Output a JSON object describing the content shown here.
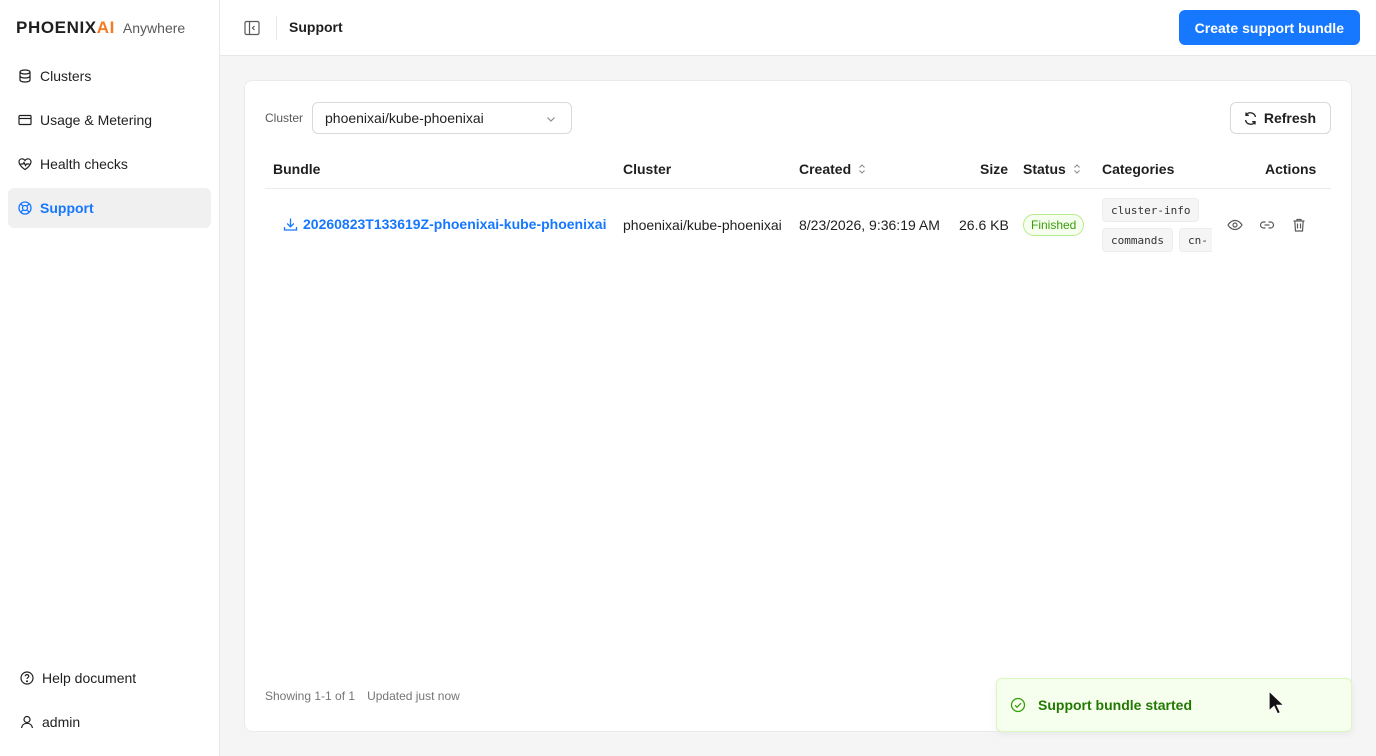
{
  "app": {
    "logo_brand": "PHOENIX",
    "logo_brand_ai": "AI",
    "logo_sub": "Anywhere"
  },
  "sidebar": {
    "items": [
      {
        "label": "Clusters",
        "icon": "database-icon"
      },
      {
        "label": "Usage & Metering",
        "icon": "card-icon"
      },
      {
        "label": "Health checks",
        "icon": "heart-pulse-icon"
      },
      {
        "label": "Support",
        "icon": "lifebuoy-icon",
        "active": true
      }
    ],
    "bottom": [
      {
        "label": "Help document",
        "icon": "help-circle-icon"
      },
      {
        "label": "admin",
        "icon": "user-icon"
      }
    ]
  },
  "header": {
    "title": "Support",
    "create_label": "Create support bundle"
  },
  "filter": {
    "label": "Cluster",
    "selected": "phoenixai/kube-phoenixai"
  },
  "refresh_label": "Refresh",
  "table": {
    "columns": [
      "Bundle",
      "Cluster",
      "Created",
      "Size",
      "Status",
      "Categories",
      "Actions"
    ],
    "rows": [
      {
        "bundle": "20260823T133619Z-phoenixai-kube-phoenixai",
        "cluster": "phoenixai/kube-phoenixai",
        "created": "8/23/2026, 9:36:19 AM",
        "size": "26.6 KB",
        "status": "Finished",
        "categories": [
          "cluster-info",
          "commands",
          "cn-"
        ]
      }
    ]
  },
  "footer": {
    "showing": "Showing 1-1 of 1",
    "updated": "Updated just now"
  },
  "toast": {
    "message": "Support bundle started"
  },
  "colors": {
    "primary": "#1677ff",
    "brand_accent": "#f47b20",
    "success": "#389e0d"
  }
}
